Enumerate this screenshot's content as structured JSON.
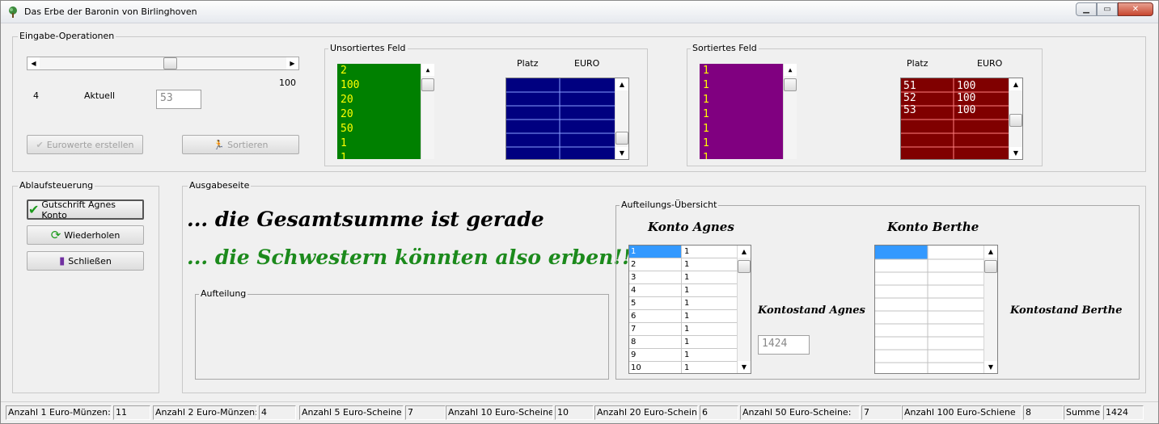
{
  "window": {
    "title": "Das Erbe der Baronin von Birlinghoven"
  },
  "eingabe": {
    "group_label": "Eingabe-Operationen",
    "slider_min": "4",
    "slider_max": "100",
    "aktuell_label": "Aktuell",
    "aktuell_value": "53",
    "slider_position": 0.53,
    "btn_eurowerte": "Eurowerte erstellen",
    "btn_sortieren": "Sortieren"
  },
  "unsortiert": {
    "group_label": "Unsortiertes Feld",
    "values": [
      "2",
      "100",
      "20",
      "20",
      "50",
      "1",
      "1"
    ],
    "col_platz": "Platz",
    "col_euro": "EURO",
    "color": "#008000"
  },
  "sortiert": {
    "group_label": "Sortiertes Feld",
    "values": [
      "1",
      "1",
      "1",
      "1",
      "1",
      "1",
      "1"
    ],
    "col_platz": "Platz",
    "col_euro": "EURO",
    "rows": [
      {
        "platz": "51",
        "euro": "100"
      },
      {
        "platz": "52",
        "euro": "100"
      },
      {
        "platz": "53",
        "euro": "100"
      }
    ],
    "color": "#800080"
  },
  "ablauf": {
    "group_label": "Ablaufsteuerung",
    "btn_gutschrift": "Gutschrift Agnes Konto",
    "btn_wiederholen": "Wiederholen",
    "btn_schliessen": "Schließen"
  },
  "ausgabe": {
    "group_label": "Ausgabeseite",
    "line1": "... die Gesamtsumme ist gerade",
    "line2": "... die Schwestern könnten also erben!!!",
    "aufteilung_label": "Aufteilung"
  },
  "uebersicht": {
    "group_label": "Aufteilungs-Übersicht",
    "konto_agnes": "Konto Agnes",
    "konto_berthe": "Konto Berthe",
    "kontostand_agnes_label": "Kontostand Agnes",
    "kontostand_berthe_label": "Kontostand Berthe",
    "kontostand_agnes_value": "1424",
    "agnes_rows": [
      {
        "n": "1",
        "v": "1"
      },
      {
        "n": "2",
        "v": "1"
      },
      {
        "n": "3",
        "v": "1"
      },
      {
        "n": "4",
        "v": "1"
      },
      {
        "n": "5",
        "v": "1"
      },
      {
        "n": "6",
        "v": "1"
      },
      {
        "n": "7",
        "v": "1"
      },
      {
        "n": "8",
        "v": "1"
      },
      {
        "n": "9",
        "v": "1"
      },
      {
        "n": "10",
        "v": "1"
      }
    ]
  },
  "status": {
    "cells": [
      {
        "label": "Anzahl 1 Euro-Münzen:",
        "value": "11"
      },
      {
        "label": "Anzahl 2 Euro-Münzen:",
        "value": "4"
      },
      {
        "label": "Anzahl 5 Euro-Scheine:",
        "value": "7"
      },
      {
        "label": "Anzahl 10 Euro-Scheine:",
        "value": "10"
      },
      {
        "label": "Anzahl 20 Euro-Scheine",
        "value": "6"
      },
      {
        "label": "Anzahl 50 Euro-Scheine:",
        "value": "7"
      },
      {
        "label": "Anzahl 100 Euro-Schiene",
        "value": "8"
      },
      {
        "label": "Summe:",
        "value": "1424"
      }
    ]
  }
}
